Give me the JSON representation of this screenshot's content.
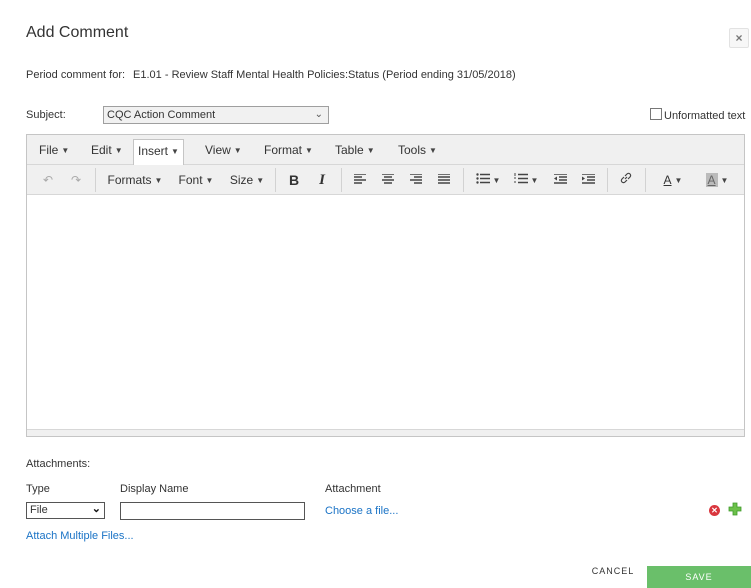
{
  "dialog": {
    "title": "Add Comment",
    "close_label": "×"
  },
  "period": {
    "label": "Period comment for:",
    "value": "E1.01 - Review Staff Mental Health Policies:Status (Period ending 31/05/2018)"
  },
  "subject": {
    "label": "Subject:",
    "selected": "CQC Action Comment"
  },
  "unformatted": {
    "label": "Unformatted text",
    "checked": false
  },
  "editor": {
    "menu": [
      "File",
      "Edit",
      "Insert",
      "View",
      "Format",
      "Table",
      "Tools"
    ],
    "active_menu": "Insert",
    "toolbar": {
      "formats": "Formats",
      "font": "Font",
      "size": "Size",
      "bold": "B",
      "italic": "I",
      "text_color": "A",
      "bg_color": "A"
    },
    "content": ""
  },
  "attachments": {
    "label": "Attachments:",
    "columns": [
      "Type",
      "Display Name",
      "Attachment"
    ],
    "rows": [
      {
        "type": "File",
        "display_name": "",
        "attachment_link": "Choose a file..."
      }
    ],
    "attach_multiple": "Attach Multiple Files..."
  },
  "actions": {
    "cancel": "CANCEL",
    "save": "SAVE"
  },
  "colors": {
    "link": "#1a73c6",
    "save_bg": "#6abf6a",
    "remove_icon": "#d9363e",
    "add_icon": "#6cc04a"
  }
}
